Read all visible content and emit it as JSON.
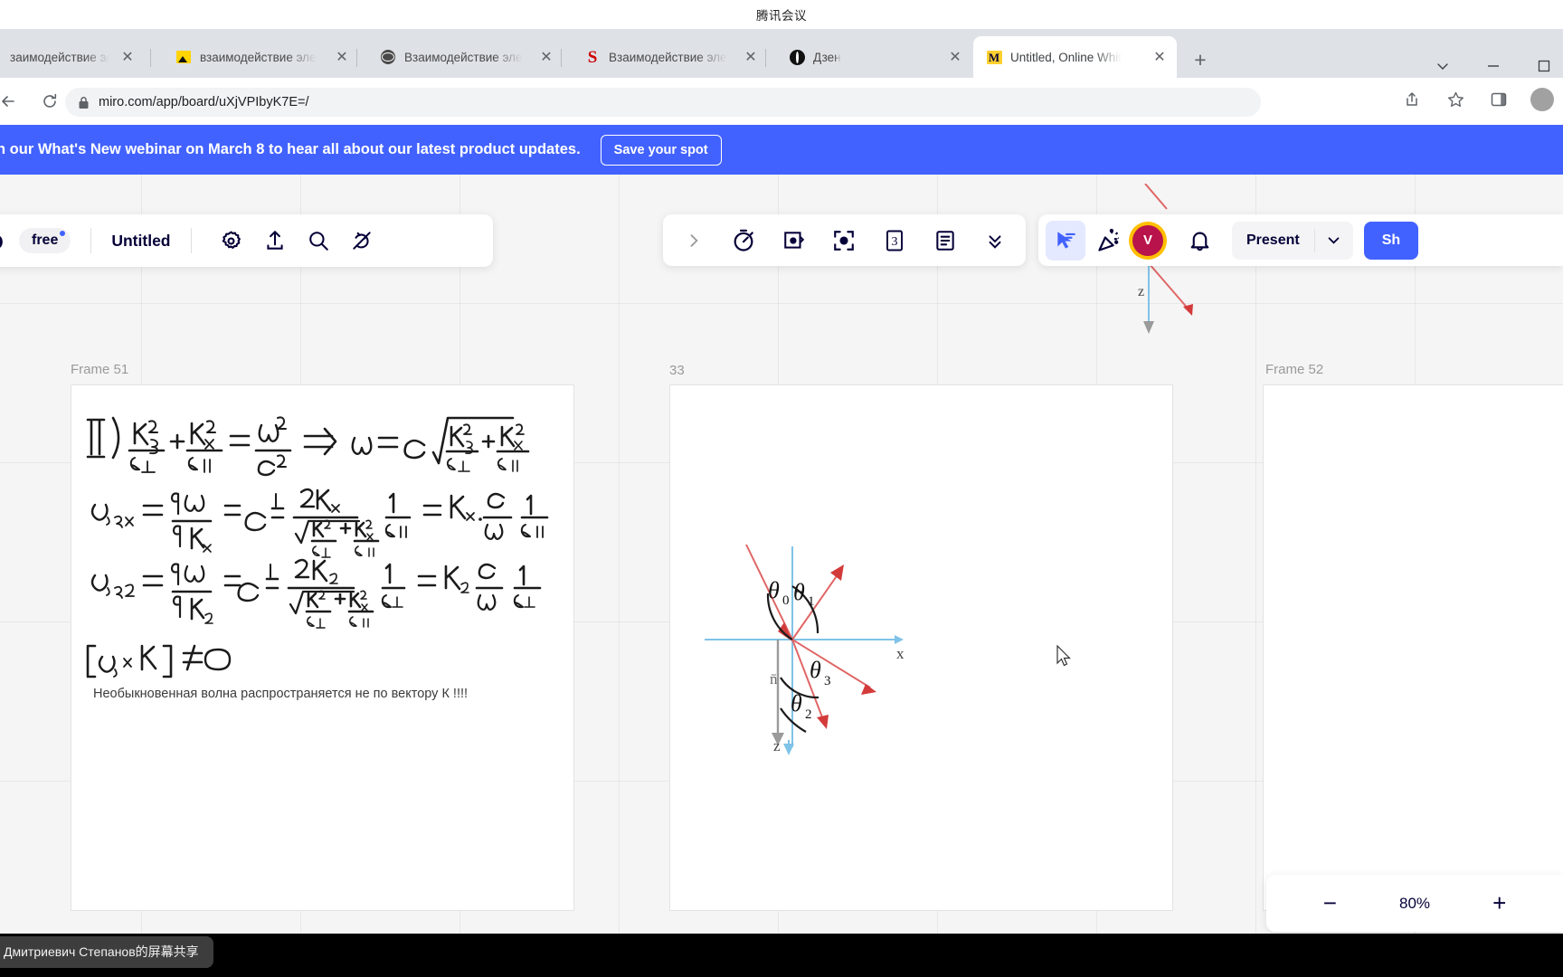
{
  "meeting": {
    "title": "腾讯会议"
  },
  "browser": {
    "tabs": [
      {
        "title": "заимодействие эле",
        "favicon": "none-icon",
        "active": false
      },
      {
        "title": "взаимодействие эле",
        "favicon": "image-icon",
        "active": false
      },
      {
        "title": "Взаимодействие эле",
        "favicon": "globe-icon",
        "active": false
      },
      {
        "title": "Взаимодействие эле",
        "favicon": "sciencedirect-icon",
        "active": false
      },
      {
        "title": "Дзен",
        "favicon": "dzen-icon",
        "active": false
      },
      {
        "title": "Untitled, Online Whit",
        "favicon": "miro-icon",
        "active": true
      }
    ],
    "new_tab_label": "+",
    "window_controls": {
      "minimize": "–",
      "restore": "▫",
      "collapse": "⌄"
    },
    "nav": {
      "back": "back-arrow",
      "reload": "reload-icon"
    },
    "omnibox": {
      "url": "miro.com/app/board/uXjVPIbyK7E=/",
      "lock": "lock-icon"
    },
    "toolbar_right": {
      "share": "share-icon",
      "bookmark": "star-icon",
      "sidepanel": "side-panel-icon",
      "profile": "profile-avatar"
    }
  },
  "banner": {
    "text": "n our What's New webinar on March 8 to hear all about our latest product updates.",
    "button": "Save your spot",
    "color": "#4262ff"
  },
  "miro": {
    "logo": "ro",
    "plan_badge": "free",
    "board_name": "Untitled",
    "header_icons": [
      "gear-icon",
      "upload-icon",
      "search-icon",
      "apps-plug-icon"
    ],
    "center_tools": [
      "chevron-right-icon",
      "timer-icon",
      "frame-icon",
      "focus-icon",
      "cards-3-icon",
      "notes-icon",
      "chevron-double-down-icon"
    ],
    "right_tools": [
      "cursor-select-icon",
      "celebrate-icon"
    ],
    "user_initial": "V",
    "notifications": "bell-icon",
    "present_label": "Present",
    "present_caret": "chevron-down-icon",
    "share_label": "Sh",
    "zoom": {
      "minus": "−",
      "value": "80%",
      "plus": "+"
    }
  },
  "canvas": {
    "frames": [
      {
        "label": "Frame 51"
      },
      {
        "label": "33"
      },
      {
        "label": "Frame 52"
      }
    ],
    "notes": {
      "line1": "II)   k²z/ε⊥ + k²x/ε‖ = ω²/c²   ⇒   ω = c √( k²z/ε⊥ + k²x/ε‖ )",
      "line2": "υ₁ₚₓ = ∂ω/∂kₓ = C · ½ · 2Kₓ / √(K²z/ε⊥ + K²x/ε‖) · 1/ε‖ = Kₓ · c/ω · 1/ε‖",
      "line3": "υ₂ₚz = ∂ω/∂kz = C · ½ · 2Kz / √(K²z/ε⊥ + K²x/ε‖) · 1/ε⊥ = Kz · c/ω · 1/ε⊥",
      "line4": "[ υₚ × K ] ≠ 0",
      "russian": "Необыкновенная волна распространяется не по вектору К !!!!"
    },
    "diagram": {
      "axis_x_label": "x",
      "axis_z_label": "z",
      "normal_label": "n̄",
      "angles": [
        "θ₀",
        "θ₁",
        "θ₃",
        "θ₂"
      ],
      "ray_color": "#e06666",
      "axis_color": "#7fc3e8"
    },
    "floating_angles": [
      "θ₂",
      "z"
    ]
  },
  "screenshare": {
    "toast": "Дмитриевич Степанов的屏幕共享"
  }
}
